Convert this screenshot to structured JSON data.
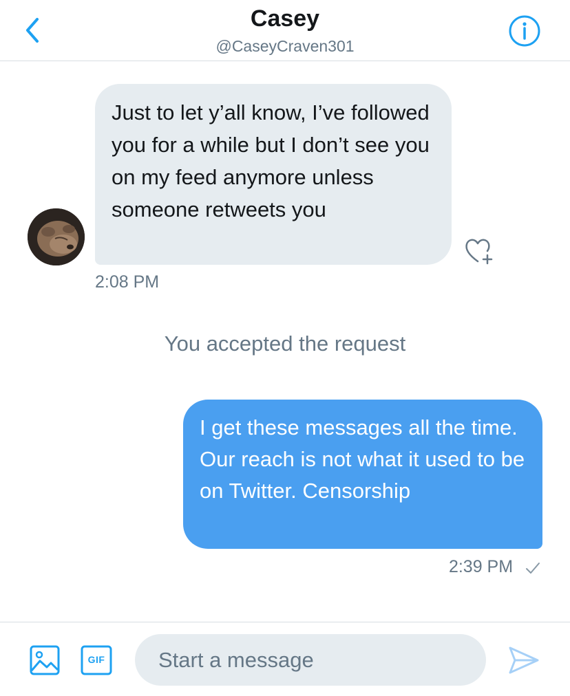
{
  "header": {
    "title": "Casey",
    "handle": "@CaseyCraven301",
    "back_icon": "chevron-left-icon",
    "info_icon": "info-circle-icon"
  },
  "conversation": {
    "incoming": {
      "text": "Just to let y’all know, I’ve followed you for a while but I don’t see you on my feed anymore unless someone retweets you",
      "time": "2:08 PM",
      "reaction_icon": "heart-plus-icon"
    },
    "system_message": "You accepted the request",
    "outgoing": {
      "text": "I get these messages all the time. Our reach is not what it used to be on Twitter. Censorship",
      "time": "2:39 PM",
      "status_icon": "checkmark-icon"
    }
  },
  "composer": {
    "placeholder": "Start a message",
    "media_icon": "image-icon",
    "gif_label": "GIF",
    "send_icon": "send-icon"
  },
  "colors": {
    "accent": "#1da1f2",
    "outgoing_bubble": "#4a9ff0",
    "incoming_bubble": "#e6ecf0",
    "secondary_text": "#657786"
  }
}
